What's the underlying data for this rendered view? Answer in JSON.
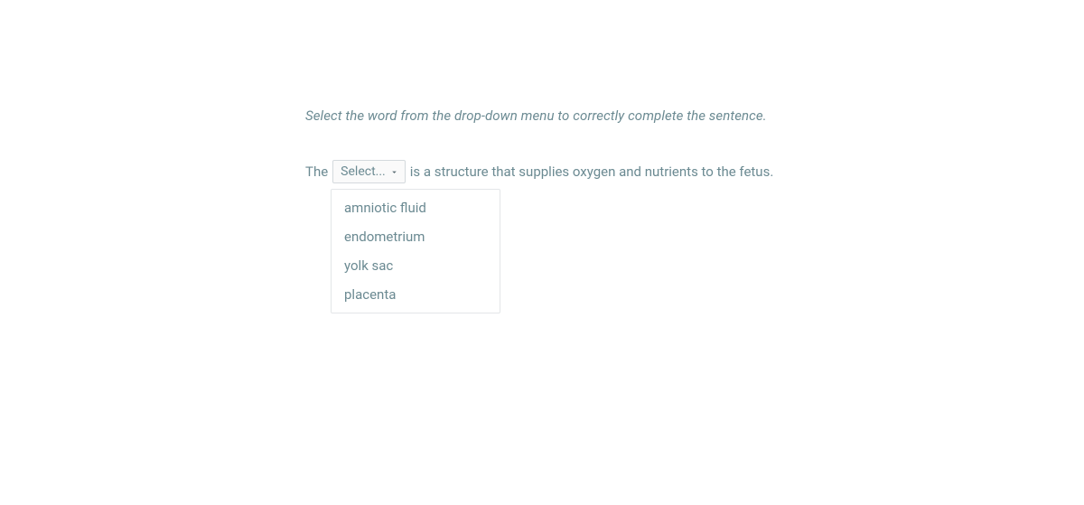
{
  "instruction": "Select the word from the drop-down menu to correctly complete the sentence.",
  "sentence": {
    "before": "The",
    "after": "is a structure that supplies oxygen and nutrients to the fetus."
  },
  "select": {
    "placeholder": "Select...",
    "options": [
      "amniotic fluid",
      "endometrium",
      "yolk sac",
      "placenta"
    ]
  }
}
